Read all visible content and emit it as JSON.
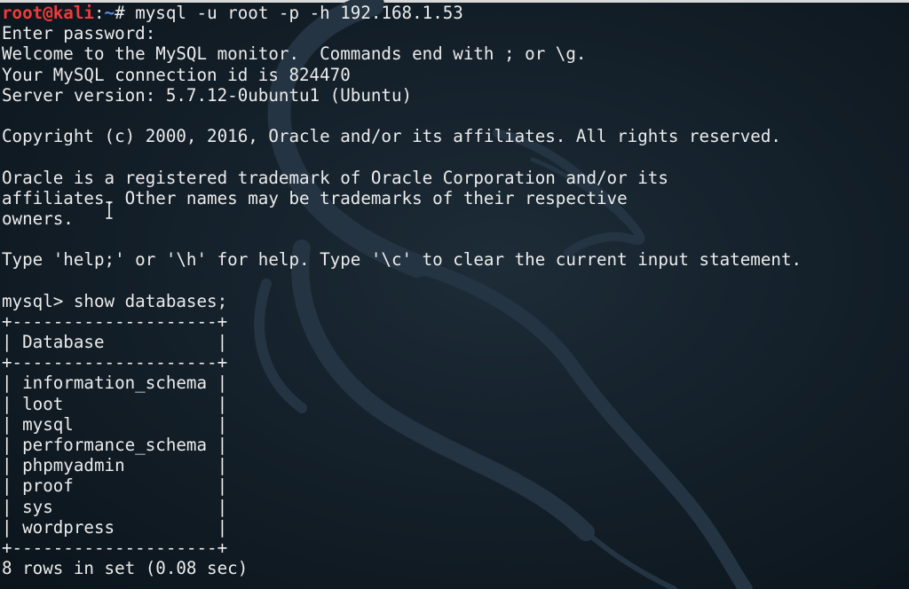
{
  "colors": {
    "background": "#14202a",
    "text": "#ececec",
    "prompt_user": "#ef3b3b",
    "prompt_path": "#5b8fe8"
  },
  "prompt": {
    "user_host": "root@kali",
    "separator": ":",
    "path": "~",
    "symbol": "# ",
    "command": "mysql -u root -p -h 192.168.1.53"
  },
  "output": [
    "Enter password:",
    "Welcome to the MySQL monitor.  Commands end with ; or \\g.",
    "Your MySQL connection id is 824470",
    "Server version: 5.7.12-0ubuntu1 (Ubuntu)",
    "",
    "Copyright (c) 2000, 2016, Oracle and/or its affiliates. All rights reserved.",
    "",
    "Oracle is a registered trademark of Oracle Corporation and/or its",
    "affiliates. Other names may be trademarks of their respective",
    "owners.",
    "",
    "Type 'help;' or '\\h' for help. Type '\\c' to clear the current input statement.",
    "",
    "mysql> show databases;",
    "+--------------------+",
    "| Database           |",
    "+--------------------+",
    "| information_schema |",
    "| loot               |",
    "| mysql              |",
    "| performance_schema |",
    "| phpmyadmin         |",
    "| proof              |",
    "| sys                |",
    "| wordpress          |",
    "+--------------------+",
    "8 rows in set (0.08 sec)"
  ],
  "icons": {
    "background_logo": "kali-dragon-icon",
    "mouse_cursor": "text-cursor-icon"
  }
}
